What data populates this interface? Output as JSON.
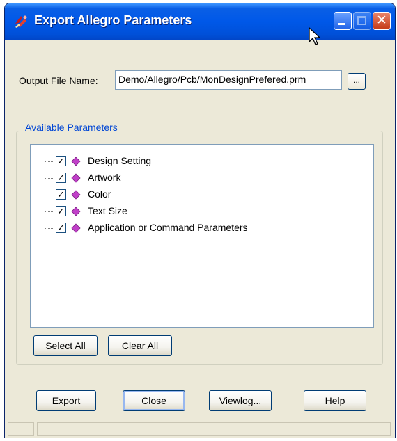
{
  "window": {
    "title": "Export Allegro Parameters",
    "app_icon": "allegro-app-icon",
    "controls": [
      "minimize-icon",
      "maximize-icon",
      "close-icon"
    ]
  },
  "output": {
    "label": "Output File Name:",
    "value": "Demo/Allegro/Pcb/MonDesignPrefered.prm",
    "browse_label": "..."
  },
  "parameters": {
    "group_label": "Available Parameters",
    "items": [
      {
        "label": "Design Setting",
        "checked": true
      },
      {
        "label": "Artwork",
        "checked": true
      },
      {
        "label": "Color",
        "checked": true
      },
      {
        "label": "Text Size",
        "checked": true
      },
      {
        "label": "Application or Command Parameters",
        "checked": true
      }
    ],
    "select_all_label": "Select All",
    "clear_all_label": "Clear All"
  },
  "buttons": {
    "export": "Export",
    "close": "Close",
    "viewlog": "Viewlog...",
    "help": "Help"
  },
  "colors": {
    "titlebar": "#0058e8",
    "group_label": "#0046d5",
    "item_icon": "#c040c8"
  }
}
